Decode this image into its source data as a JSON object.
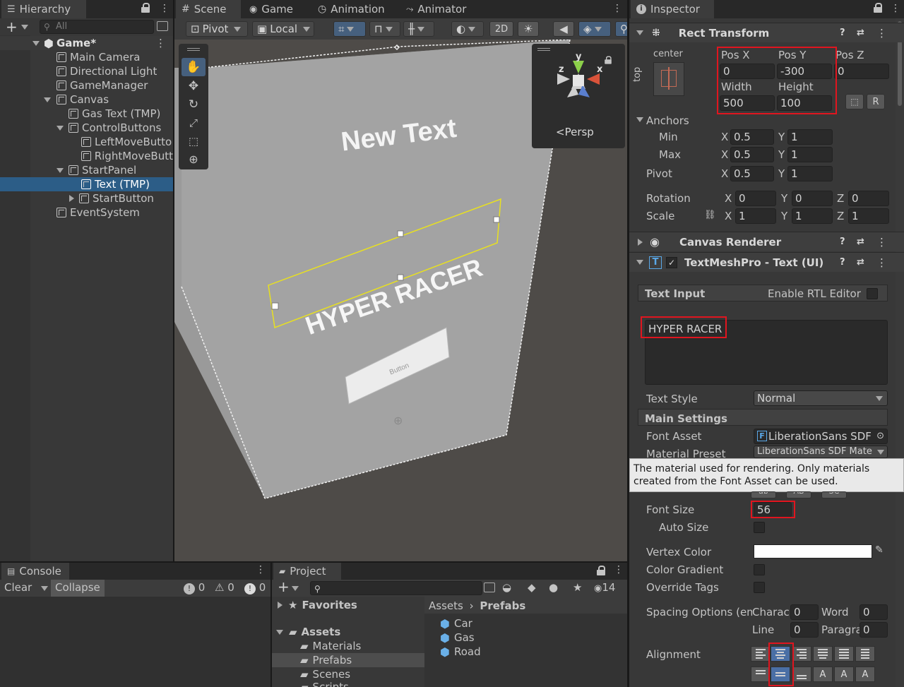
{
  "hierarchy": {
    "tab": "Hierarchy",
    "search_placeholder": "All",
    "scene": "Game*",
    "items": [
      {
        "label": "Main Camera"
      },
      {
        "label": "Directional Light"
      },
      {
        "label": "GameManager"
      },
      {
        "label": "Canvas"
      },
      {
        "label": "Gas Text (TMP)"
      },
      {
        "label": "ControlButtons"
      },
      {
        "label": "LeftMoveButto"
      },
      {
        "label": "RightMoveButt"
      },
      {
        "label": "StartPanel"
      },
      {
        "label": "Text (TMP)"
      },
      {
        "label": "StartButton"
      },
      {
        "label": "EventSystem"
      }
    ]
  },
  "center_tabs": {
    "scene": "Scene",
    "game": "Game",
    "animation": "Animation",
    "animator": "Animator"
  },
  "scene_toolbar": {
    "pivot": "Pivot",
    "local": "Local",
    "mode_2d": "2D"
  },
  "scene_view": {
    "new_text": "New Text",
    "hyper_racer": "HYPER RACER",
    "button_label": "Button",
    "persp": "Persp",
    "axis_y": "y",
    "axis_x": "x",
    "axis_z": "z"
  },
  "console": {
    "tab": "Console",
    "clear": "Clear",
    "collapse": "Collapse",
    "info_count": "0",
    "warn_count": "0",
    "error_count": "0"
  },
  "project": {
    "tab": "Project",
    "hidden_count": "14",
    "favorites": "Favorites",
    "assets": "Assets",
    "folders": [
      "Materials",
      "Prefabs",
      "Scenes",
      "Scripts"
    ],
    "breadcrumb_root": "Assets",
    "breadcrumb_sep": "›",
    "breadcrumb_current": "Prefabs",
    "files": [
      "Car",
      "Gas",
      "Road"
    ]
  },
  "inspector": {
    "tab": "Inspector",
    "rect_transform": {
      "title": "Rect Transform",
      "anchor_h": "center",
      "anchor_v": "top",
      "pos_x_label": "Pos X",
      "pos_x": "0",
      "pos_y_label": "Pos Y",
      "pos_y": "-300",
      "pos_z_label": "Pos Z",
      "pos_z": "0",
      "width_label": "Width",
      "width": "500",
      "height_label": "Height",
      "height": "100",
      "anchors_label": "Anchors",
      "min_label": "Min",
      "min_x": "0.5",
      "min_y": "1",
      "max_label": "Max",
      "max_x": "0.5",
      "max_y": "1",
      "pivot_label": "Pivot",
      "pivot_x": "0.5",
      "pivot_y": "1",
      "rotation_label": "Rotation",
      "rot_x": "0",
      "rot_y": "0",
      "rot_z": "0",
      "scale_label": "Scale",
      "scale_x": "1",
      "scale_y": "1",
      "scale_z": "1",
      "x": "X",
      "y": "Y",
      "z": "Z",
      "btn_r": "R"
    },
    "canvas_renderer": {
      "title": "Canvas Renderer"
    },
    "tmp": {
      "title": "TextMeshPro - Text (UI)",
      "text_input_label": "Text Input",
      "rtl_label": "Enable RTL Editor",
      "text_value": "HYPER RACER",
      "text_style_label": "Text Style",
      "text_style": "Normal",
      "main_settings": "Main Settings",
      "font_asset_label": "Font Asset",
      "font_asset": "LiberationSans SDF",
      "material_preset_label": "Material Preset",
      "material_preset": "LiberationSans SDF Mate",
      "tooltip": "The material used for rendering. Only materials created from the Font Asset can be used.",
      "style_b": "ab",
      "style_i": "AB",
      "style_u": "SC",
      "font_size_label": "Font Size",
      "font_size": "56",
      "auto_size_label": "Auto Size",
      "vertex_color_label": "Vertex Color",
      "vertex_color": "#ffffff",
      "color_gradient_label": "Color Gradient",
      "override_tags_label": "Override Tags",
      "spacing_label": "Spacing Options (em)",
      "char_label": "Charac",
      "char_value": "0",
      "word_label": "Word",
      "word_value": "0",
      "line_label": "Line",
      "line_value": "0",
      "para_label": "Paragra",
      "para_value": "0",
      "alignment_label": "Alignment"
    }
  },
  "colors": {
    "accent": "#2c5d87",
    "highlight": "#e0151f",
    "selection": "#2c5d87"
  }
}
